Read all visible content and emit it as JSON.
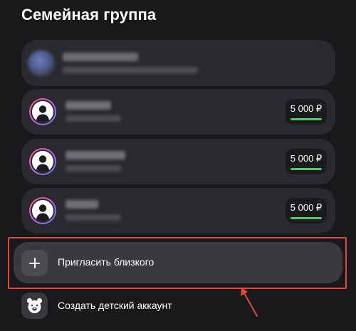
{
  "page": {
    "title": "Семейная группа"
  },
  "owner": {
    "name": "",
    "subtitle": ""
  },
  "members": [
    {
      "limit": "5 000 ₽",
      "limit_fill_fraction": 1.0
    },
    {
      "limit": "5 000 ₽",
      "limit_fill_fraction": 1.0
    },
    {
      "limit": "5 000 ₽",
      "limit_fill_fraction": 1.0
    }
  ],
  "actions": {
    "invite": {
      "label": "Пригласить близкого",
      "icon": "plus-icon"
    },
    "child_account": {
      "label": "Создать детский аккаунт",
      "icon": "bear-face-icon"
    }
  },
  "colors": {
    "background": "#19191c",
    "card": "#2a2a2e",
    "highlight": "#e2483a",
    "limit_bar": "#52c96b"
  }
}
